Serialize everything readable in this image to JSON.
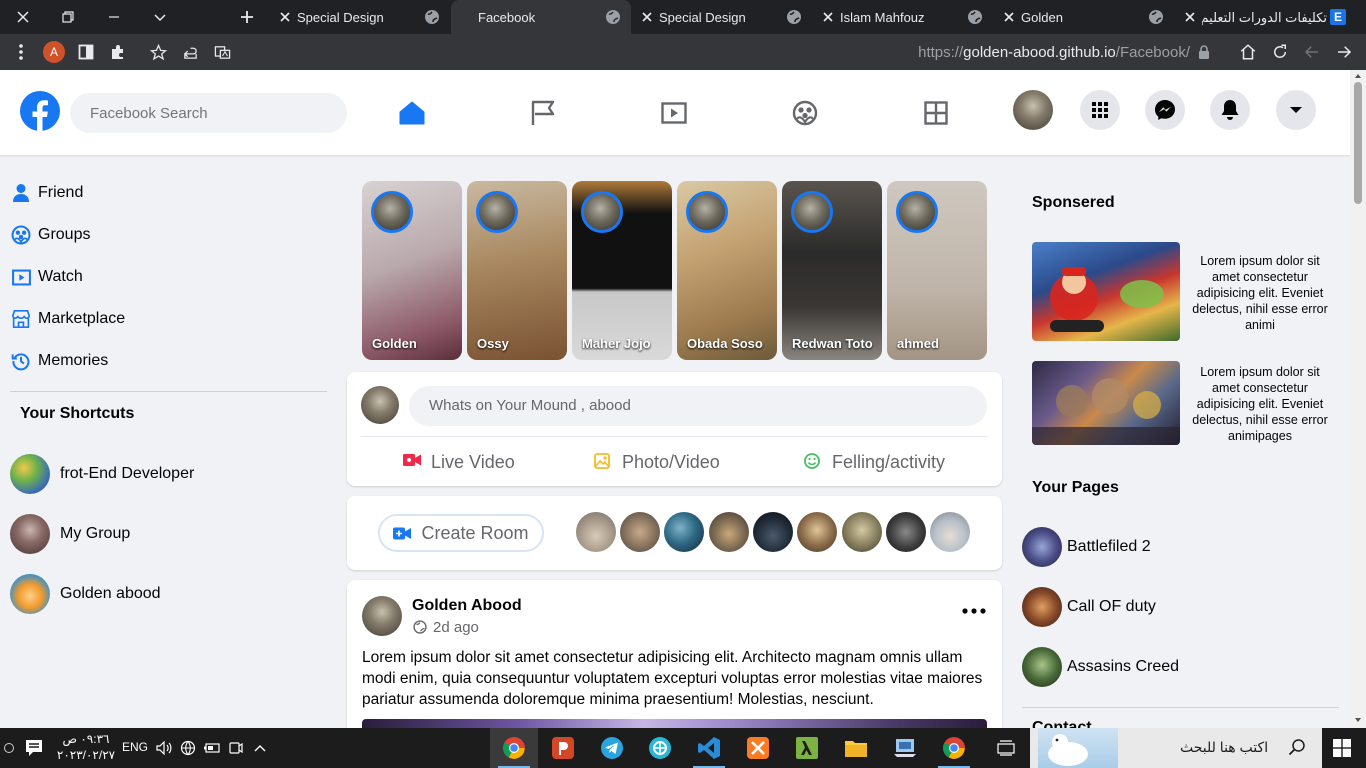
{
  "browser": {
    "tabs": [
      {
        "title": "Special Design"
      },
      {
        "title": "Facebook"
      },
      {
        "title": "Special Design"
      },
      {
        "title": "Islam Mahfouz"
      },
      {
        "title": "Golden"
      },
      {
        "title": "تكليفات الدورات التعليم"
      }
    ],
    "active_tab": 1,
    "profile_initial": "A",
    "url_prefix": "https://",
    "url_host": "golden-abood.github.io",
    "url_path": "/Facebook/"
  },
  "header": {
    "search_placeholder": "Facebook Search"
  },
  "left_nav": [
    {
      "label": "Friend",
      "icon": "person-icon"
    },
    {
      "label": "Groups",
      "icon": "groups-icon"
    },
    {
      "label": "Watch",
      "icon": "watch-icon"
    },
    {
      "label": "Marketplace",
      "icon": "marketplace-icon"
    },
    {
      "label": "Memories",
      "icon": "memories-icon"
    }
  ],
  "shortcuts": {
    "title": "Your Shortcuts",
    "items": [
      {
        "label": "frot-End Developer"
      },
      {
        "label": "My Group"
      },
      {
        "label": "Golden abood"
      }
    ]
  },
  "stories": [
    {
      "name": "Golden"
    },
    {
      "name": "Ossy"
    },
    {
      "name": "Maher Jojo"
    },
    {
      "name": "Obada Soso"
    },
    {
      "name": "Redwan Toto"
    },
    {
      "name": "ahmed"
    }
  ],
  "composer": {
    "placeholder": "Whats on Your Mound , abood",
    "actions": [
      {
        "label": "Live Video"
      },
      {
        "label": "Photo/Video"
      },
      {
        "label": "Felling/activity"
      }
    ]
  },
  "rooms": {
    "create_label": "Create Room"
  },
  "post": {
    "author": "Golden Abood",
    "time": "2d ago",
    "text": "Lorem ipsum dolor sit amet consectetur adipisicing elit. Architecto magnam omnis ullam modi enim, quia consequuntur voluptatem excepturi voluptas error molestias vitae maiores pariatur assumenda doloremque minima praesentium! Molestias, nesciunt."
  },
  "sponsored": {
    "title": "Sponsered",
    "ads": [
      {
        "text": "Lorem ipsum dolor sit amet consectetur adipisicing elit. Eveniet delectus, nihil esse error animi"
      },
      {
        "text": "Lorem ipsum dolor sit amet consectetur adipisicing elit. Eveniet delectus, nihil esse error animipages"
      }
    ]
  },
  "your_pages": {
    "title": "Your Pages",
    "items": [
      {
        "label": "Battlefiled 2"
      },
      {
        "label": "Call OF duty"
      },
      {
        "label": "Assasins Creed"
      }
    ],
    "next_section_partial": "Contact"
  },
  "taskbar": {
    "time": "٠٩:٣٦ ص",
    "date": "٢٠٢٣/٠٢/٢٧",
    "lang": "ENG",
    "search_placeholder": "اكتب هنا للبحث"
  },
  "colors": {
    "accent": "#1877f2",
    "live": "#f02849",
    "photo": "#f7b928",
    "feeling": "#45bd62"
  }
}
